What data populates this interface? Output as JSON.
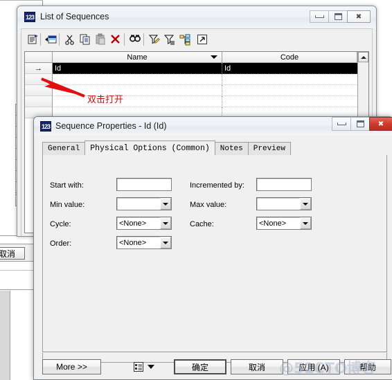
{
  "list_window": {
    "icon": "123-icon",
    "title": "List of Sequences",
    "minimize_label": "Minimize",
    "maximize_label": "Maximize",
    "close_label": "Close",
    "toolbar": [
      {
        "name": "properties-icon",
        "tooltip": "Properties"
      },
      {
        "name": "insert-row-icon",
        "tooltip": "Insert a Row"
      },
      {
        "name": "cut-icon",
        "tooltip": "Cut"
      },
      {
        "name": "copy-icon",
        "tooltip": "Copy"
      },
      {
        "name": "paste-icon",
        "tooltip": "Paste"
      },
      {
        "name": "delete-icon",
        "tooltip": "Delete"
      },
      {
        "name": "find-icon",
        "tooltip": "Find"
      },
      {
        "name": "edit-filter-icon",
        "tooltip": "Define Filter"
      },
      {
        "name": "apply-filter-icon",
        "tooltip": "Apply Filter"
      },
      {
        "name": "include-subpackages-icon",
        "tooltip": "Include Sub-Packages"
      },
      {
        "name": "open-icon",
        "tooltip": "Open"
      }
    ],
    "grid": {
      "columns": [
        "",
        "Name",
        "Code"
      ],
      "sorted_column": "Name",
      "rows": [
        {
          "indicator": "→",
          "name": "Id",
          "code": "Id",
          "selected": true
        },
        {
          "indicator": "",
          "name": "",
          "code": "",
          "selected": false
        },
        {
          "indicator": "",
          "name": "",
          "code": "",
          "selected": false
        },
        {
          "indicator": "",
          "name": "",
          "code": "",
          "selected": false
        },
        {
          "indicator": "",
          "name": "",
          "code": "",
          "selected": false
        }
      ]
    }
  },
  "annotation": {
    "text": "双击打开",
    "color": "#d01010",
    "arrow": "red-arrow-icon"
  },
  "left_window": {
    "cancel_label": "取消",
    "scroll_left_label": "Scroll Left"
  },
  "dialog": {
    "icon": "123-icon",
    "title": "Sequence Properties - Id (Id)",
    "minimize_label": "Minimize",
    "maximize_label": "Maximize",
    "close_label": "Close",
    "tabs": [
      {
        "label": "General",
        "active": false
      },
      {
        "label": "Physical Options (Common)",
        "active": true
      },
      {
        "label": "Notes",
        "active": false
      },
      {
        "label": "Preview",
        "active": false
      }
    ],
    "fields": {
      "start_with": {
        "label": "Start with:",
        "value": "",
        "type": "text"
      },
      "incremented_by": {
        "label": "Incremented by:",
        "value": "",
        "type": "text"
      },
      "min_value": {
        "label": "Min value:",
        "value": "",
        "type": "combo"
      },
      "max_value": {
        "label": "Max value:",
        "value": "",
        "type": "combo"
      },
      "cycle": {
        "label": "Cycle:",
        "value": "<None>",
        "type": "combo"
      },
      "cache": {
        "label": "Cache:",
        "value": "<None>",
        "type": "combo"
      },
      "order": {
        "label": "Order:",
        "value": "<None>",
        "type": "combo"
      }
    },
    "buttons": {
      "more": "More >>",
      "menu_icon": "list-menu-icon",
      "ok": "确定",
      "cancel": "取消",
      "apply": "应用 (A)",
      "help": "帮助"
    }
  },
  "watermark": {
    "text": "@51CTO博客"
  }
}
